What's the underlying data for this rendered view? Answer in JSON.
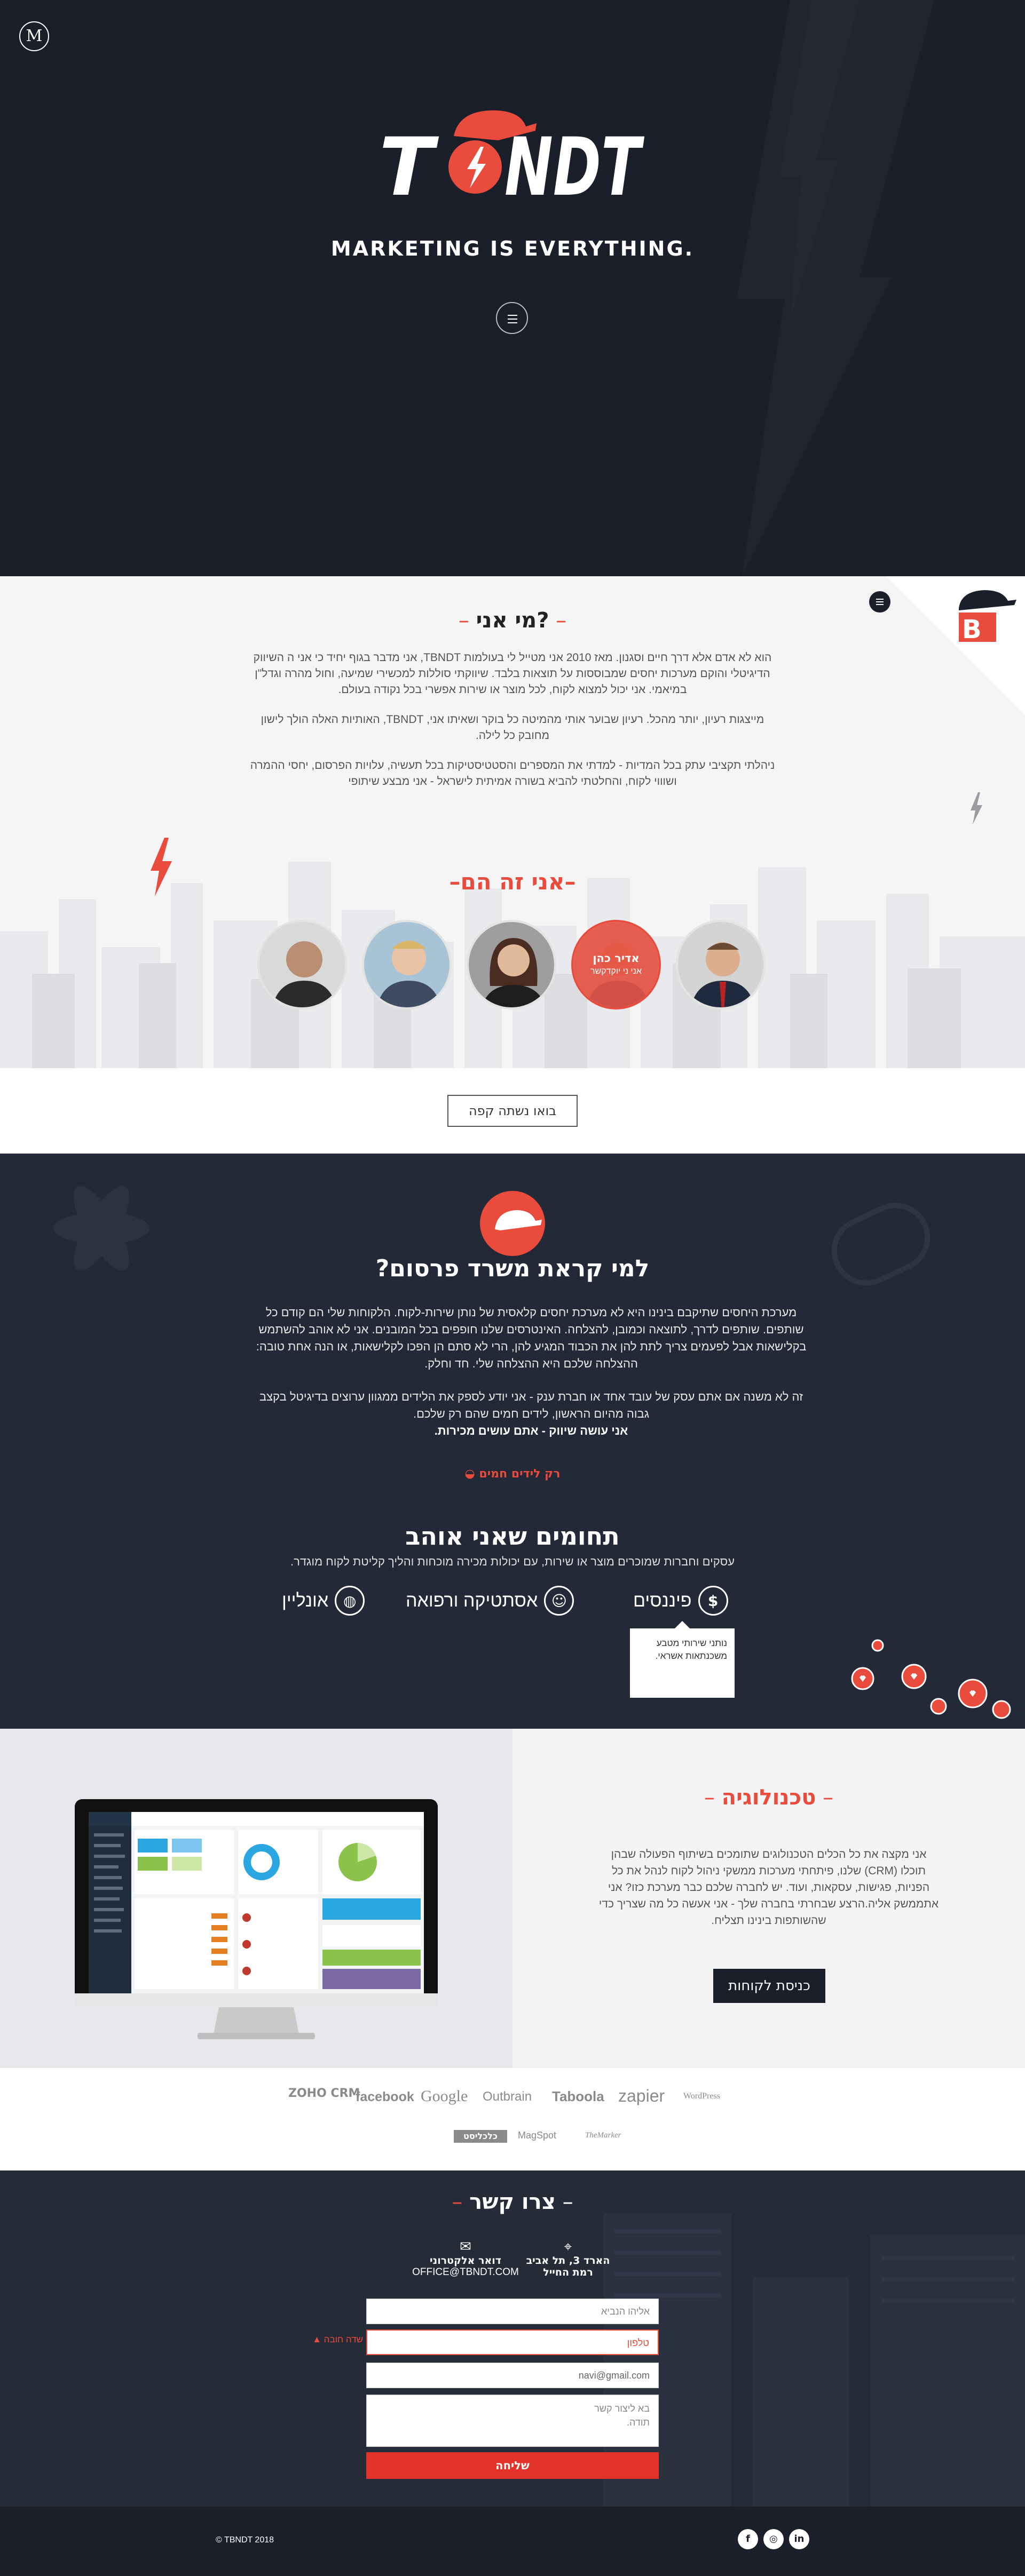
{
  "hero": {
    "m_logo": "M",
    "brand_text": "TBNDT",
    "tagline": "MARKETING IS EVERYTHING."
  },
  "about": {
    "title": "מי אני?",
    "paragraphs": [
      "הוא לא אדם אלא דרך חיים וסגנון. מאז 2010 אני מטייל לי בעולמות TBNDT, אני מדבר בגוף יחיד כי אני ה השיווק הדיגיטלי והוקם מערכות יחסים שמבוססות על תוצאות בלבד. שיווקתי סוללות למכשירי שמיעה, וחול מהרה וגדל\"ן במיאמי. אני יכול למצוא לקוח, לכל מוצר או שירות אפשרי בכל נקודה בעולם.",
      "מייצגות רעיון, יותר מהכל. רעיון שבוער אותי מהמיטה כל בוקר ושאיתו אני, TBNDT, האותיות האלה הולך לישון מחובק כל לילה.",
      "ניהלתי תקציבי עתק בכל המדיות - למדתי את המספרים והסטטיסטיקות בכל תעשיה, עלויות הפרסום, יחסי ההמרה ושוווי לקוח, והחלטתי להביא בשורה אמיתית לישראל - אני מבצע שיתופי"
    ],
    "team_title": "אני זה הם",
    "team": [
      {
        "name": "",
        "role": ""
      },
      {
        "name": "",
        "role": ""
      },
      {
        "name": "",
        "role": ""
      },
      {
        "name": "אדיר כהן",
        "role": "אני ני יוקדקשר"
      },
      {
        "name": "",
        "role": ""
      }
    ],
    "coffee_button": "בואו נשתה קפה"
  },
  "why": {
    "title": "למי קראת משרד פרסום?",
    "p1": "מערכת היחסים שתיקבם בינינו היא לא מערכת יחסים קלאסית של נותן שירות-לקוח. הלקוחות שלי הם קודם כל שותפים. שותפים לדרך, לתוצאה וכמובן, להצלחה. האינטרסים שלנו חופפים בכל המובנים. אני לא אוהב להשתמש בקלישאות אבל לפעמים צריך לתת להן את הכבוד המגיע להן, הרי לא סתם הן הפכו לקלישאות, או הנה אחת טובה: ההצלחה שלכם היא ההצלחה שלי. חד וחלק.",
    "p2": "זה לא משנה אם אתם עסק של עובד אחד או חברת ענק - אני יודע לספק את הלידים ממגוון ערוצים בדיגיטל בקצב גבוה מהיום הראשון, לידים חמים שהם רק שלכם.",
    "p2_bold": "אני עושה שיווק - אתם עושים מכירות.",
    "cta": "רק לידים חמים",
    "fields_title": "תחומים שאני אוהב",
    "fields_sub": "עסקים וחברות שמוכרים מוצר או שירות, עם יכולות מכירה מוכחות והליך קליטת לקוח מוגדר.",
    "fields": [
      {
        "label": "פיננסים",
        "icon": "dollar-icon"
      },
      {
        "label": "אסתטיקה ורפואה",
        "icon": "face-icon"
      },
      {
        "label": "אונליין",
        "icon": "globe-icon"
      }
    ],
    "tooltip": "נותני שירותי מטבע משכנתאות אשראי."
  },
  "tech": {
    "title": "טכנולוגיה",
    "text": "אני מקצה את כל הכלים הטכנולוגים שתומכים בשיתוף הפעולה שבהן תוכלו (CRM) שלנו, פיתחתי מערכות ממשקי ניהול לקוח לנהל את כל הפניות, פגישות, עסקאות, ועוד. יש לחברה שלכם כבר מערכת כזו? אני אתממשק אליה.הרצע שבחרתי בחברה שלך - אני אעשה כל מה שצריך כדי שהשותפות בינינו תצליח.",
    "button": "כניסת לקוחות",
    "dashboard_title": "Dashboard"
  },
  "logos": {
    "row1": [
      "ZOHO CRM",
      "facebook",
      "Google",
      "Outbrain",
      "Taboola",
      "zapier",
      "WordPress"
    ],
    "row2": [
      "כלכליסט",
      "MagSpot",
      "TheMarker"
    ]
  },
  "contact": {
    "title": "צרו קשר",
    "address_line1": "הארד 3, תל אביב",
    "address_line2": "רמת החייל",
    "email_label": "דואר אלקטרוני",
    "email_value": "OFFICE@TBNDT.COM",
    "inputs": {
      "name": "אליהו הנביא",
      "phone": "טלפון",
      "email": "navi@gmail.com",
      "message_line1": "בא ליצור קשר",
      "message_line2": "תודה."
    },
    "error_note": "שדה חובה",
    "send": "שליחה"
  },
  "footer": {
    "copyright": "© TBNDT 2018"
  }
}
